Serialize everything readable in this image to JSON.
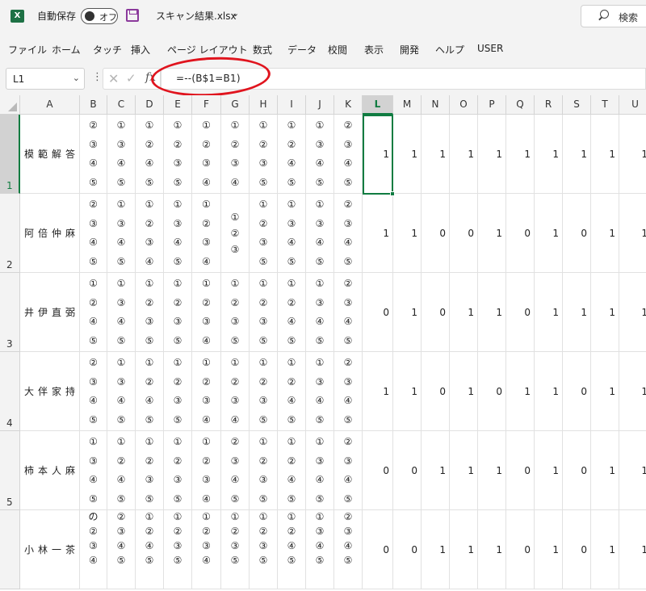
{
  "titlebar": {
    "app_icon": "X",
    "autosave_label": "自動保存",
    "autosave_state": "オフ",
    "filename": "スキャン結果.xlsx",
    "search_placeholder": "検索"
  },
  "menu": [
    "ファイル",
    "ホーム",
    "タッチ",
    "挿入",
    "ページ レイアウト",
    "数式",
    "データ",
    "校閲",
    "表示",
    "開発",
    "ヘルプ",
    "USER"
  ],
  "formula_bar": {
    "cell_ref": "L1",
    "formula": "=--(B$1=B1)",
    "annotation_color": "#e0141e"
  },
  "colors": {
    "accent": "#107c41",
    "excel_brand": "#1e7145",
    "save_icon": "#8b3a9c"
  },
  "sheet": {
    "columns": [
      "A",
      "B",
      "C",
      "D",
      "E",
      "F",
      "G",
      "H",
      "I",
      "J",
      "K",
      "L",
      "M",
      "N",
      "O",
      "P",
      "Q",
      "R",
      "S",
      "T",
      "U"
    ],
    "selected_column": "L",
    "rows": [
      {
        "num": "1",
        "name": "模範解答",
        "marks": [
          [
            "②",
            "③",
            "④",
            "⑤"
          ],
          [
            "①",
            "③",
            "④",
            "⑤"
          ],
          [
            "①",
            "②",
            "④",
            "⑤"
          ],
          [
            "①",
            "②",
            "③",
            "⑤"
          ],
          [
            "①",
            "②",
            "③",
            "④"
          ],
          [
            "①",
            "②",
            "③",
            "④"
          ],
          [
            "①",
            "②",
            "③",
            "⑤"
          ],
          [
            "①",
            "②",
            "④",
            "⑤"
          ],
          [
            "①",
            "③",
            "④",
            "⑤"
          ],
          [
            "②",
            "③",
            "④",
            "⑤"
          ]
        ],
        "scores": [
          "1",
          "1",
          "1",
          "1",
          "1",
          "1",
          "1",
          "1",
          "1",
          "1"
        ]
      },
      {
        "num": "2",
        "name": "阿倍仲麻",
        "marks": [
          [
            "②",
            "③",
            "④",
            "⑤"
          ],
          [
            "①",
            "③",
            "④",
            "⑤"
          ],
          [
            "①",
            "②",
            "③",
            "④"
          ],
          [
            "①",
            "③",
            "④",
            "⑤"
          ],
          [
            "①",
            "②",
            "③",
            "④"
          ],
          [
            "①",
            "②",
            "③"
          ],
          [
            "①",
            "②",
            "③",
            "⑤"
          ],
          [
            "①",
            "③",
            "④",
            "⑤"
          ],
          [
            "①",
            "③",
            "④",
            "⑤"
          ],
          [
            "②",
            "③",
            "④",
            "⑤"
          ]
        ],
        "scores": [
          "1",
          "1",
          "0",
          "0",
          "1",
          "0",
          "1",
          "0",
          "1",
          "1"
        ]
      },
      {
        "num": "3",
        "name": "井伊直弼",
        "marks": [
          [
            "①",
            "②",
            "④",
            "⑤"
          ],
          [
            "①",
            "③",
            "④",
            "⑤"
          ],
          [
            "①",
            "②",
            "③",
            "⑤"
          ],
          [
            "①",
            "②",
            "③",
            "⑤"
          ],
          [
            "①",
            "②",
            "③",
            "④"
          ],
          [
            "①",
            "②",
            "③",
            "⑤"
          ],
          [
            "①",
            "②",
            "③",
            "⑤"
          ],
          [
            "①",
            "②",
            "④",
            "⑤"
          ],
          [
            "①",
            "③",
            "④",
            "⑤"
          ],
          [
            "②",
            "③",
            "④",
            "⑤"
          ]
        ],
        "scores": [
          "0",
          "1",
          "0",
          "1",
          "1",
          "0",
          "1",
          "1",
          "1",
          "1"
        ]
      },
      {
        "num": "4",
        "name": "大伴家持",
        "marks": [
          [
            "②",
            "③",
            "④",
            "⑤"
          ],
          [
            "①",
            "③",
            "④",
            "⑤"
          ],
          [
            "①",
            "②",
            "④",
            "⑤"
          ],
          [
            "①",
            "②",
            "③",
            "⑤"
          ],
          [
            "①",
            "②",
            "③",
            "④"
          ],
          [
            "①",
            "②",
            "③",
            "④"
          ],
          [
            "①",
            "②",
            "③",
            "⑤"
          ],
          [
            "①",
            "②",
            "④",
            "⑤"
          ],
          [
            "①",
            "③",
            "④",
            "⑤"
          ],
          [
            "②",
            "③",
            "④",
            "⑤"
          ]
        ],
        "scores": [
          "1",
          "1",
          "0",
          "1",
          "0",
          "1",
          "1",
          "0",
          "1",
          "1"
        ]
      },
      {
        "num": "5",
        "name": "柿本人麻",
        "marks": [
          [
            "①",
            "③",
            "④",
            "⑤"
          ],
          [
            "①",
            "②",
            "④",
            "⑤"
          ],
          [
            "①",
            "②",
            "③",
            "⑤"
          ],
          [
            "①",
            "②",
            "③",
            "⑤"
          ],
          [
            "①",
            "②",
            "③",
            "④"
          ],
          [
            "②",
            "③",
            "④",
            "⑤"
          ],
          [
            "①",
            "②",
            "③",
            "⑤"
          ],
          [
            "①",
            "②",
            "④",
            "⑤"
          ],
          [
            "①",
            "③",
            "④",
            "⑤"
          ],
          [
            "②",
            "③",
            "④",
            "⑤"
          ]
        ],
        "scores": [
          "0",
          "0",
          "1",
          "1",
          "1",
          "0",
          "1",
          "0",
          "1",
          "1"
        ]
      },
      {
        "num": "",
        "name": "小林一茶",
        "marks": [
          [
            "の",
            "②",
            "③",
            "④"
          ],
          [
            "②",
            "③",
            "④",
            "⑤"
          ],
          [
            "①",
            "②",
            "④",
            "⑤"
          ],
          [
            "①",
            "②",
            "③",
            "⑤"
          ],
          [
            "①",
            "②",
            "③",
            "④"
          ],
          [
            "①",
            "②",
            "③",
            "⑤"
          ],
          [
            "①",
            "②",
            "③",
            "⑤"
          ],
          [
            "①",
            "②",
            "④",
            "⑤"
          ],
          [
            "①",
            "③",
            "④",
            "⑤"
          ],
          [
            "②",
            "③",
            "④",
            "⑤"
          ]
        ],
        "scores": [
          "0",
          "0",
          "1",
          "1",
          "1",
          "0",
          "1",
          "0",
          "1",
          "1"
        ]
      }
    ]
  }
}
